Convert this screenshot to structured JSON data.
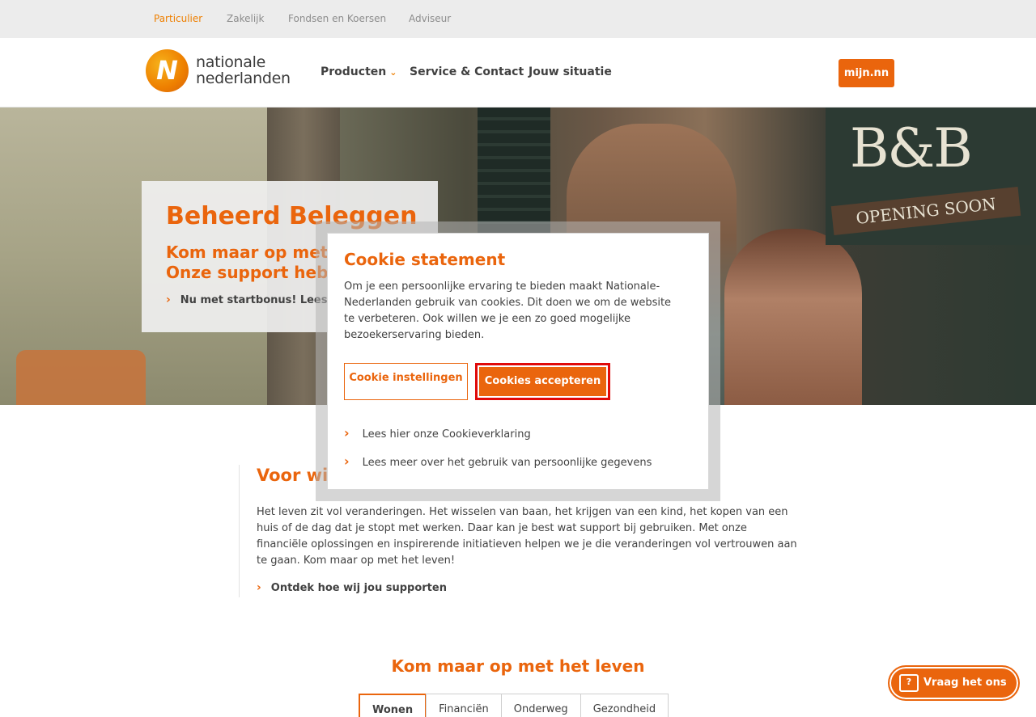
{
  "topbar": {
    "links": [
      "Particulier",
      "Zakelijk",
      "Fondsen en Koersen",
      "Adviseur"
    ]
  },
  "header": {
    "logo_line1": "nationale",
    "logo_line2": "nederlanden",
    "nav": {
      "producten": "Producten",
      "service": "Service & Contact",
      "situatie": "Jouw situatie"
    },
    "mijn": "mijn.nn"
  },
  "hero": {
    "sign_text": "B&B",
    "sign_sub": "OPENING SOON",
    "title": "Beheerd Beleggen",
    "subtitle_line1": "Kom maar op met",
    "subtitle_line2": "Onze support heb",
    "link": "Nu met startbonus! Lees"
  },
  "section": {
    "heading": "Voor wie",
    "body": "Het leven zit vol veranderingen. Het wisselen van baan, het krijgen van een kind, het kopen van een huis of de dag dat je stopt met werken. Daar kan je best wat support bij gebruiken. Met onze financiële oplossingen en inspirerende initiatieven helpen we je die veranderingen vol vertrouwen aan te gaan. Kom maar op met het leven!",
    "link": "Ontdek hoe wij jou supporten"
  },
  "kom": "Kom maar op met het leven",
  "tabs": [
    "Wonen",
    "Financiën",
    "Onderweg",
    "Gezondheid"
  ],
  "vraag": "Vraag het ons",
  "cookie": {
    "title": "Cookie statement",
    "body": "Om je een persoonlijke ervaring te bieden maakt Nationale-Nederlanden gebruik van cookies. Dit doen we om de website te verbeteren. Ook willen we je een zo goed mogelijke bezoekerservaring bieden.",
    "settings": "Cookie instellingen",
    "accept": "Cookies accepteren",
    "link1": "Lees hier onze Cookieverklaring",
    "link2": "Lees meer over het gebruik van persoonlijke gegevens"
  },
  "colors": {
    "accent": "#ea650d",
    "highlight": "#e00a0a"
  }
}
